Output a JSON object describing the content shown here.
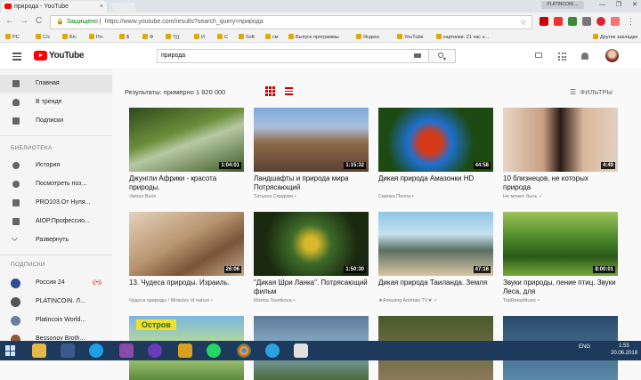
{
  "browser": {
    "tab_title": "природа - YouTube",
    "tab_close": "×",
    "profile": "PLATINCOIN ...",
    "win_buttons": "— ❐ ✕",
    "back": "←",
    "forward": "→",
    "reload": "C",
    "secure_label": "Защищено",
    "url": "https://www.youtube.com/results?search_query=природа",
    "star": "☆",
    "bookmarks": [
      "РС",
      "С/с",
      "Б/с",
      "Р.п.",
      "$",
      "Ф",
      "*(((",
      "И",
      "С",
      "Soft",
      "см",
      "Выпуск программы",
      "Яндекс",
      "YouTube",
      "картинки: 21 час н..."
    ],
    "other_bookmarks": "Другие закладки"
  },
  "youtube": {
    "logo_text": "YouTube",
    "search_value": "природа"
  },
  "sidebar": {
    "main": [
      {
        "label": "Главная",
        "icon": "home-icon"
      },
      {
        "label": "В тренде",
        "icon": "fire-icon"
      },
      {
        "label": "Подписки",
        "icon": "subscriptions-icon"
      }
    ],
    "library_header": "БИБЛИОТЕКА",
    "library": [
      {
        "label": "История",
        "icon": "history-icon"
      },
      {
        "label": "Посмотреть поз...",
        "icon": "clock-icon"
      },
      {
        "label": "PRO103.От Нуля...",
        "icon": "playlist-icon"
      },
      {
        "label": "AIOP.Профессио...",
        "icon": "playlist-icon"
      },
      {
        "label": "Развернуть",
        "icon": "chevron-down-icon"
      }
    ],
    "subs_header": "ПОДПИСКИ",
    "subs": [
      {
        "label": "Россия 24",
        "color": "#2a4f9a",
        "live": "((•))"
      },
      {
        "label": "PLATINCOIN. Л...",
        "color": "#555555",
        "live": ""
      },
      {
        "label": "Platincoin World...",
        "color": "#6a7d9a",
        "live": ""
      },
      {
        "label": "Bessonov Broth...",
        "color": "#8a5a3a",
        "live": ""
      }
    ]
  },
  "results": {
    "count_text": "Результаты: примерно 1 820 000",
    "filters_label": "ФИЛЬТРЫ"
  },
  "videos": [
    {
      "title": "Джунгли Африки - красота природы.",
      "channel": "James Burin",
      "duration": "1:04:01",
      "bg": "linear-gradient(160deg,#2d4a1e,#6b8f3a 40%,#b7c9a2 55%,#3e5a28)"
    },
    {
      "title": "Ландшафты и природа мира Потрясающий",
      "channel": "Татьяна Свидова •",
      "duration": "1:15:32",
      "bg": "linear-gradient(180deg,#7fa8d8,#a8c1de 30%,#8e6a4a 55%,#5a4032)"
    },
    {
      "title": "Дикая природа Амазонки HD",
      "channel": "Свинка Пеппа •",
      "duration": "44:58",
      "bg": "radial-gradient(circle at 45% 55%,#d43a1a 15%,#1f6fd0 30%,#1c4a12 60%)"
    },
    {
      "title": "10 близнецов, не которых природа",
      "channel": "Не может быть ✓",
      "duration": "4:49",
      "bg": "linear-gradient(90deg,#e8d5c4,#c79f83 35%,#2a1a14 50%,#d9b79c 70%,#e3d0c0)"
    },
    {
      "title": "13. Чудеса природы. Израиль.",
      "channel": "Чудеса природы / Miracles of nature •",
      "duration": "26:06",
      "bg": "linear-gradient(150deg,#e4d2bb,#b89570 45%,#7a5438 70%,#c7ab8a)"
    },
    {
      "title": "\"Дикая Шри Ланка\". Потрясающий фильм",
      "channel": "Marina Tsvetkova •",
      "duration": "1:50:30",
      "bg": "radial-gradient(circle at 50% 50%,#d8b82a 10%,#3e6b2a 30%,#1a2a10 70%)"
    },
    {
      "title": "Дикая природа Таиланда. Земля",
      "channel": "★Amazing Animals TV★ ✓",
      "duration": "47:16",
      "bg": "linear-gradient(180deg,#8ec6e6,#c7e1ee 35%,#5b6f63 60%,#d7c8a4)"
    },
    {
      "title": "Звуки природы, пение птиц. Звуки Леса, для",
      "channel": "TopRelaxMusic •",
      "duration": "8:00:01",
      "bg": "linear-gradient(180deg,#9ec35a,#4f8a2a 40%,#2a5a1a 70%,#7aa83a)"
    },
    {
      "title": "",
      "channel": "",
      "duration": "",
      "bg": "linear-gradient(180deg,#7ab6e0,#bde090 50%,#5a8a3a)",
      "overlay": "Остров"
    },
    {
      "title": "",
      "channel": "",
      "duration": "",
      "bg": "linear-gradient(180deg,#5c7a9a,#8ab0c8 50%,#4a6a3a)"
    },
    {
      "title": "",
      "channel": "",
      "duration": "",
      "bg": "linear-gradient(180deg,#4a5a2a,#8a7a5a)"
    },
    {
      "title": "",
      "channel": "",
      "duration": "",
      "bg": "linear-gradient(180deg,#2a4a6a,#5a8aaa)"
    }
  ],
  "taskbar": {
    "tray": "ENG",
    "time": "1:55",
    "date": "20.06.2018"
  }
}
